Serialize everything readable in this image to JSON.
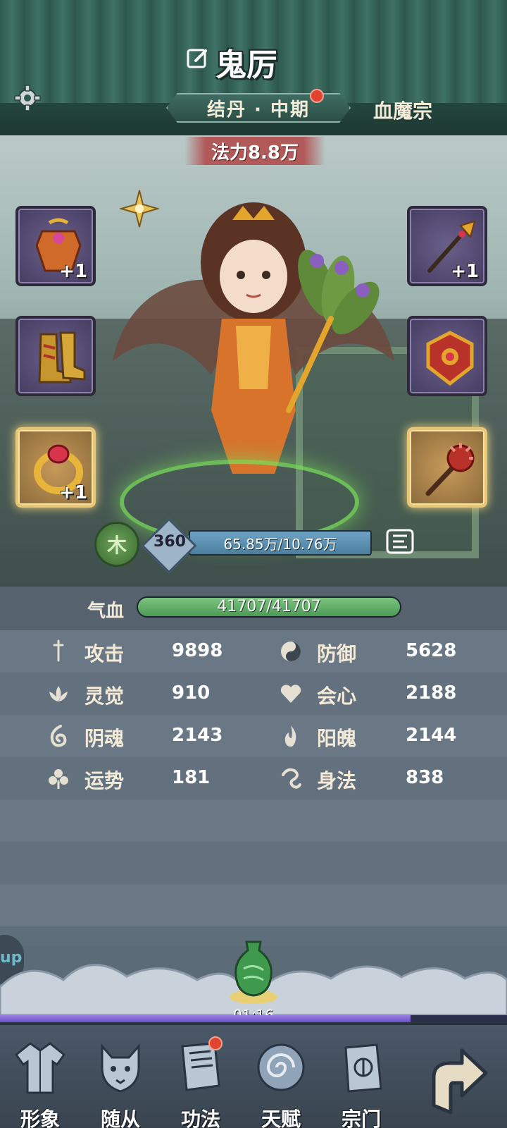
{
  "header": {
    "name": "鬼厉",
    "realm": "结丹 · 中期",
    "sect": "血魔宗"
  },
  "scene": {
    "power": "法力8.8万",
    "element": "木",
    "level": "360",
    "exp_text": "65.85万/10.76万",
    "exp_progress": 1.0
  },
  "equipment": {
    "left": [
      {
        "name": "armor",
        "plus": "+1"
      },
      {
        "name": "boots",
        "plus": ""
      },
      {
        "name": "ring",
        "plus": "+1"
      }
    ],
    "right": [
      {
        "name": "spear",
        "plus": "+1"
      },
      {
        "name": "amulet",
        "plus": ""
      },
      {
        "name": "mace",
        "plus": ""
      }
    ]
  },
  "stats": {
    "hp_label": "气血",
    "hp_text": "41707/41707",
    "hp_progress": 1.0,
    "rows": [
      {
        "left_name": "攻击",
        "left_value": "9898",
        "right_name": "防御",
        "right_value": "5628"
      },
      {
        "left_name": "灵觉",
        "left_value": "910",
        "right_name": "会心",
        "right_value": "2188"
      },
      {
        "left_name": "阴魂",
        "left_value": "2143",
        "right_name": "阳魄",
        "right_value": "2144"
      },
      {
        "left_name": "运势",
        "left_value": "181",
        "right_name": "身法",
        "right_value": "838"
      }
    ]
  },
  "side_tab": "up",
  "timer": "01:16",
  "timer_progress": 0.81,
  "nav": [
    "形象",
    "随从",
    "功法",
    "天赋",
    "宗门"
  ],
  "colors": {
    "accent_red": "#e2432f",
    "hp_green": "#5bac62",
    "exp_blue": "#5d92b3",
    "progress_purple": "#7b62d6"
  }
}
